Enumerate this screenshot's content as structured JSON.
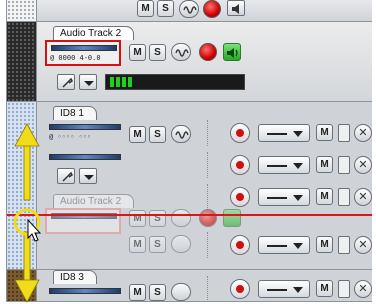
{
  "tracks": [
    {
      "name": "Audio Track 2",
      "mute": "M",
      "solo": "S"
    },
    {
      "name": "ID8 1",
      "mute": "M",
      "solo": "S"
    },
    {
      "name": "Audio Track 2",
      "mute": "M",
      "solo": "S"
    },
    {
      "name": "ID8 3",
      "mute": "M",
      "solo": "S"
    }
  ],
  "top_strip": {
    "mute": "M",
    "solo": "S"
  },
  "plugin_readout": "@ 0000 4-0.0",
  "lanes": [
    {
      "mute": "M",
      "close": "✕"
    },
    {
      "mute": "M",
      "close": "✕"
    },
    {
      "mute": "M",
      "close": "✕"
    },
    {
      "mute": "M",
      "close": "✕"
    }
  ],
  "colors": {
    "accent_red": "#d41010",
    "drag_arrow": "#f0dc1a",
    "meter_green": "#20d020"
  }
}
